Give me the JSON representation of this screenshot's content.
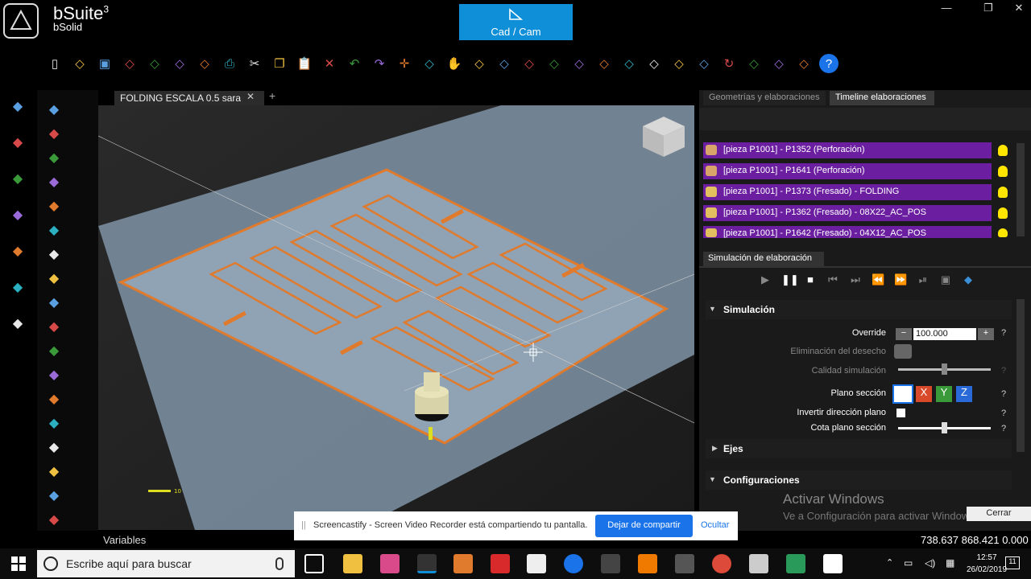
{
  "app": {
    "brand": "bSuite",
    "brand_sup": "3",
    "brand_sub": "bSolid",
    "mode_label": "Cad / Cam",
    "window_controls": [
      "minimize-icon",
      "restore-icon",
      "close-icon"
    ]
  },
  "toolbar": {
    "icons": [
      "new-file-icon",
      "open-folder-icon",
      "save-icon",
      "save-as-icon",
      "print-setup-icon",
      "import-icon",
      "export-icon",
      "print-icon",
      "cut-icon",
      "copy-icon",
      "paste-icon",
      "delete-icon",
      "undo-icon",
      "redo-icon",
      "move-icon",
      "rotate-view-icon",
      "pan-hand-icon",
      "zoom-fit-icon",
      "view-front-icon",
      "view-back-icon",
      "view-left-icon",
      "view-right-icon",
      "view-top-icon",
      "view-bottom-icon",
      "view-iso-icon",
      "view-3d-icon",
      "green-arrow-icon",
      "refresh-icon",
      "globe-grid-icon",
      "sphere-dark-icon",
      "sphere-blue-icon",
      "help-icon"
    ]
  },
  "left_panel": {
    "col1": [
      "drawing-icon",
      "resize-icon",
      "line-tool-icon",
      "measure-icon",
      "pin-icon",
      "shield-icon",
      "tools-icon"
    ],
    "col2": [
      "move-arrows-icon",
      "rotate-icon",
      "scale-icon",
      "mirror-icon",
      "offset-icon",
      "link-icon",
      "boolean-icon",
      "fillet-icon",
      "text-z-icon",
      "corner-icon",
      "arc-corner-icon",
      "slot-icon",
      "array-icon",
      "split-icon",
      "align-icon",
      "trim-icon",
      "palette-icon",
      "cube-wire-icon"
    ]
  },
  "document": {
    "tab_title": "FOLDING ESCALA 0.5 sara",
    "close": "✕",
    "add": "+",
    "scale_label": "10"
  },
  "right_panel": {
    "tabs": [
      "Geometrías y elaboraciones",
      "Timeline elaboraciones"
    ],
    "timeline": [
      "[pieza P1001] - P1352 (Perforación)",
      "[pieza P1001] - P1641 (Perforación)",
      "[pieza P1001] - P1373 (Fresado) - FOLDING",
      "[pieza P1001] - P1362 (Fresado) - 08X22_AC_POS",
      "[pieza P1001] - P1642 (Fresado) - 04X12_AC_POS"
    ],
    "sim_tab": "Simulación de elaboración",
    "controls": [
      "play-icon",
      "pause-icon",
      "stop-icon",
      "step-start-icon",
      "step-end-icon",
      "skip-back-icon",
      "skip-forward-icon",
      "skip-last-icon",
      "camera-icon",
      "settings-icon"
    ],
    "section_sim": "Simulación",
    "override_label": "Override",
    "override_value": "100.000",
    "minus": "−",
    "plus": "+",
    "waste_label": "Eliminación del desecho",
    "quality_label": "Calidad simulación",
    "quality_level": 0.5,
    "plane_label": "Plano sección",
    "plane_buttons": [
      "X",
      "Y",
      "Z"
    ],
    "invert_label": "Invertir dirección plano",
    "height_label": "Cota plano sección",
    "height_level": 0.5,
    "section_axes": "Ejes",
    "section_config": "Configuraciones",
    "help": "?"
  },
  "watermark": {
    "title": "Activar Windows",
    "subtitle": "Ve a Configuración para activar Windows."
  },
  "share": {
    "text": "Screencastify - Screen Video Recorder está compartiendo tu pantalla.",
    "stop": "Dejar de compartir",
    "hide": "Ocultar",
    "close_popup": "Cerrar"
  },
  "status": {
    "variables": "Variables",
    "coords": "738.637  868.421  0.000"
  },
  "taskbar": {
    "search": "Escribe aquí para buscar",
    "time": "12:57",
    "date": "26/02/2019",
    "notifications": "11"
  },
  "colors": {
    "accent": "#0f8fd8",
    "timeline_row": "#6b1fa0",
    "toolpath": "#e07a2c",
    "plate": "#8fa3b5"
  }
}
